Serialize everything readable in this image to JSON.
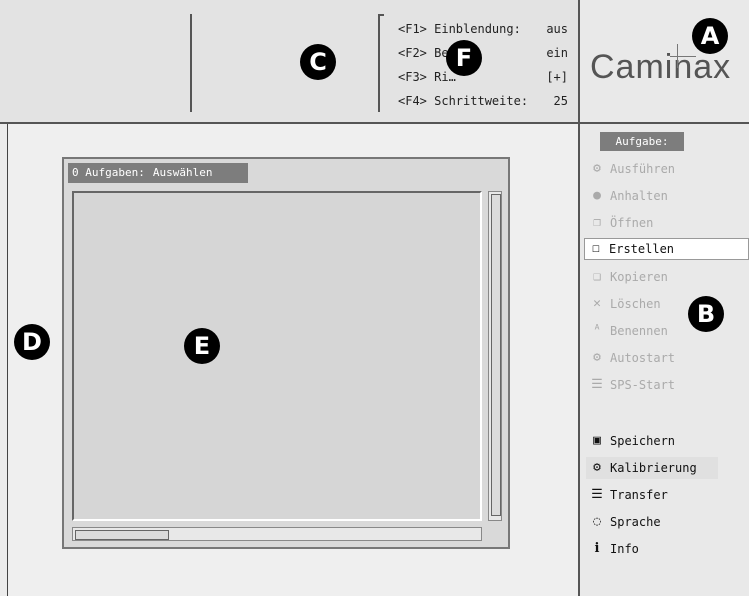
{
  "header": {
    "fkeys": [
      {
        "key": "<F1> Einblendung:",
        "value": "aus"
      },
      {
        "key": "<F2> Be…",
        "value": "ein"
      },
      {
        "key": "<F3> Ri…",
        "value": "[+]"
      },
      {
        "key": "<F4> Schrittweite:",
        "value": "25"
      }
    ]
  },
  "logo": {
    "text": "Caminax"
  },
  "panel": {
    "count_label": "0 Aufgaben:",
    "mode_label": "Auswählen"
  },
  "sidebar": {
    "header": "Aufgabe:",
    "items": [
      {
        "label": "Ausführen",
        "icon": "gear-icon",
        "glyph": "⚙"
      },
      {
        "label": "Anhalten",
        "icon": "stop-icon",
        "glyph": "●"
      },
      {
        "label": "Öffnen",
        "icon": "folder-open-icon",
        "glyph": "❐"
      },
      {
        "label": "Erstellen",
        "icon": "new-file-icon",
        "glyph": "☐"
      },
      {
        "label": "Kopieren",
        "icon": "copy-icon",
        "glyph": "❑"
      },
      {
        "label": "Löschen",
        "icon": "delete-icon",
        "glyph": "✕"
      },
      {
        "label": "Benennen",
        "icon": "rename-icon",
        "glyph": "ᴬ"
      },
      {
        "label": "Autostart",
        "icon": "autostart-gear-icon",
        "glyph": "⚙"
      },
      {
        "label": "SPS-Start",
        "icon": "plc-start-icon",
        "glyph": "☰"
      },
      {
        "label": "Speichern",
        "icon": "save-icon",
        "glyph": "▣"
      },
      {
        "label": "Kalibrierung",
        "icon": "calibration-icon",
        "glyph": "⚙"
      },
      {
        "label": "Transfer",
        "icon": "transfer-icon",
        "glyph": "☰"
      },
      {
        "label": "Sprache",
        "icon": "speech-bubble-icon",
        "glyph": "◌"
      },
      {
        "label": "Info",
        "icon": "info-icon",
        "glyph": "i"
      }
    ]
  },
  "markers": {
    "a": "A",
    "b": "B",
    "c": "C",
    "d": "D",
    "e": "E",
    "f": "F"
  }
}
